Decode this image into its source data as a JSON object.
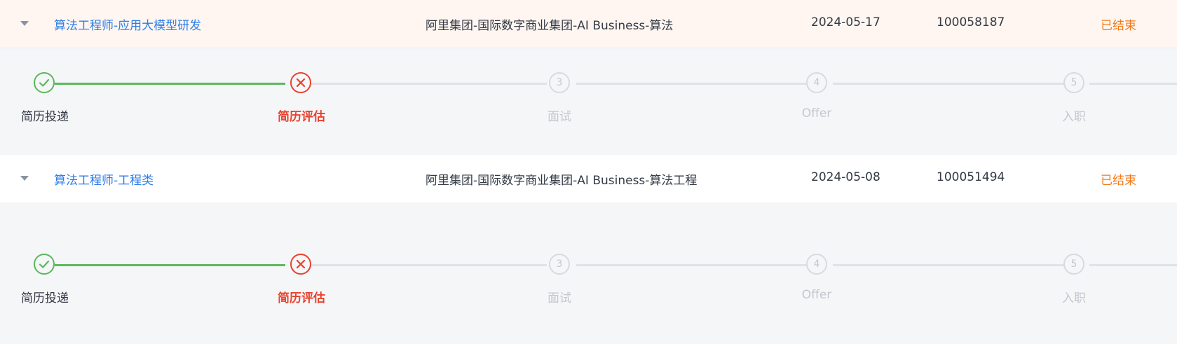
{
  "applications": [
    {
      "title": "算法工程师-应用大模型研发",
      "department": "阿里集团-国际数字商业集团-AI Business-算法",
      "date": "2024-05-17",
      "id": "100058187",
      "status": "已结束",
      "steps": [
        {
          "label": "简历投递",
          "state": "done",
          "icon": "check-icon"
        },
        {
          "label": "简历评估",
          "state": "failed",
          "icon": "close-icon"
        },
        {
          "label": "面试",
          "state": "pending",
          "number": "3"
        },
        {
          "label": "Offer",
          "state": "pending",
          "number": "4"
        },
        {
          "label": "入职",
          "state": "pending",
          "number": "5"
        }
      ]
    },
    {
      "title": "算法工程师-工程类",
      "department": "阿里集团-国际数字商业集团-AI Business-算法工程",
      "date": "2024-05-08",
      "id": "100051494",
      "status": "已结束",
      "steps": [
        {
          "label": "简历投递",
          "state": "done",
          "icon": "check-icon"
        },
        {
          "label": "简历评估",
          "state": "failed",
          "icon": "close-icon"
        },
        {
          "label": "面试",
          "state": "pending",
          "number": "3"
        },
        {
          "label": "Offer",
          "state": "pending",
          "number": "4"
        },
        {
          "label": "入职",
          "state": "pending",
          "number": "5"
        }
      ]
    }
  ],
  "colors": {
    "title_link": "#2f7ee6",
    "status_ended": "#f07a19",
    "step_done": "#5cb85c",
    "step_failed": "#e8412e",
    "step_pending": "#c3c8cf"
  }
}
